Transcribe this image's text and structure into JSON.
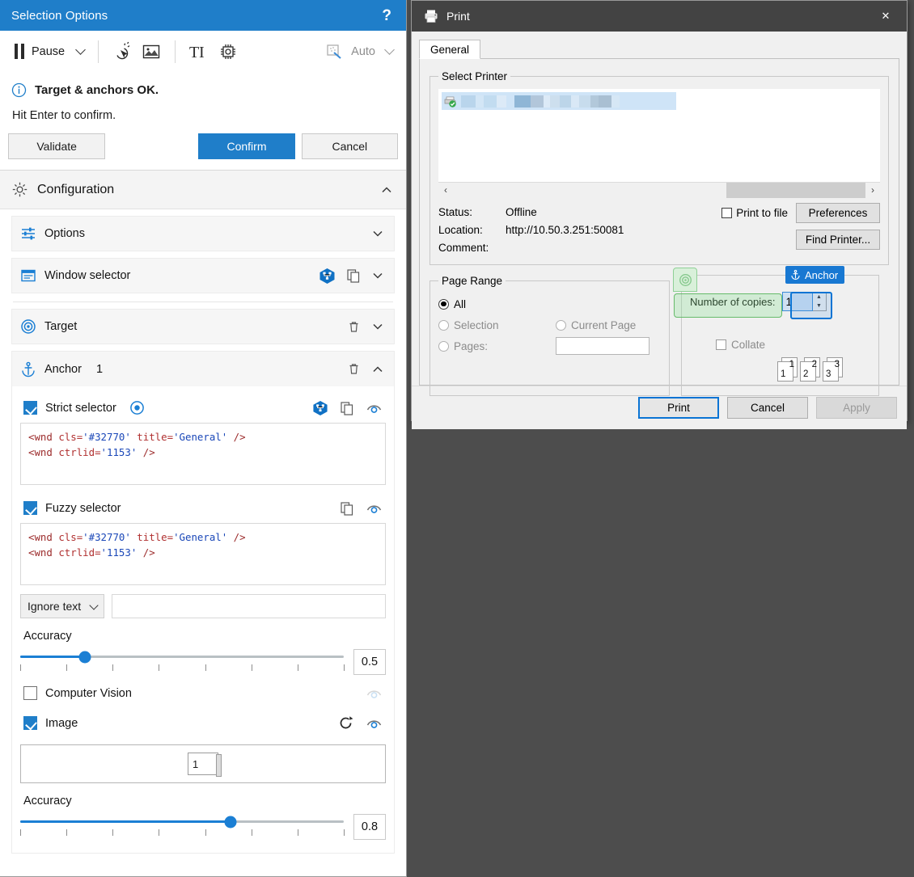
{
  "selection_panel": {
    "title": "Selection Options",
    "help_label": "?",
    "toolbar": {
      "pause_label": "Pause",
      "icons": [
        "click-action-icon",
        "image-capture-icon",
        "text-capture-icon",
        "cpu-automation-icon"
      ],
      "auto_label": "Auto"
    },
    "status": {
      "headline": "Target & anchors OK.",
      "subtext": "Hit Enter to confirm."
    },
    "buttons": {
      "validate": "Validate",
      "confirm": "Confirm",
      "cancel": "Cancel"
    },
    "configuration": {
      "title": "Configuration",
      "cards": [
        {
          "label": "Options",
          "icon": "sliders-icon"
        },
        {
          "label": "Window selector",
          "icon": "window-icon"
        }
      ],
      "target": {
        "label": "Target",
        "icon": "target-icon"
      },
      "anchor": {
        "label": "Anchor",
        "index": "1",
        "icon": "anchor-icon"
      }
    },
    "anchor_body": {
      "strict_selector": {
        "label": "Strict selector",
        "checked": true,
        "code_line1_parts": {
          "tag1": "<wnd ",
          "attr1": "cls=",
          "val1": "'#32770'",
          "attr2": " title=",
          "val2": "'General'",
          "close": " />"
        },
        "code_line2_parts": {
          "tag1": "<wnd ",
          "attr1": "ctrlid=",
          "val1": "'1153'",
          "close": " />"
        }
      },
      "fuzzy_selector": {
        "label": "Fuzzy selector",
        "checked": true,
        "code_line1_parts": {
          "tag1": "<wnd ",
          "attr1": "cls=",
          "val1": "'#32770'",
          "attr2": " title=",
          "val2": "'General'",
          "close": " />"
        },
        "code_line2_parts": {
          "tag1": "<wnd ",
          "attr1": "ctrlid=",
          "val1": "'1153'",
          "close": " />"
        }
      },
      "ignore_text": {
        "label": "Ignore text",
        "value": ""
      },
      "accuracy_selector": {
        "label": "Accuracy",
        "value": "0.5",
        "percent": 20
      },
      "computer_vision": {
        "label": "Computer Vision",
        "checked": false
      },
      "image": {
        "label": "Image",
        "checked": true,
        "thumb_value": "1"
      },
      "accuracy_image": {
        "label": "Accuracy",
        "value": "0.8",
        "percent": 65
      }
    }
  },
  "print_dialog": {
    "title": "Print",
    "close_label": "✕",
    "tabs": [
      {
        "label": "General",
        "active": true
      }
    ],
    "select_printer": {
      "legend": "Select Printer",
      "printer_name_redacted": true
    },
    "details": {
      "status_key": "Status:",
      "status_value": "Offline",
      "location_key": "Location:",
      "location_value": "http://10.50.3.251:50081",
      "comment_key": "Comment:",
      "comment_value": ""
    },
    "print_to_file": {
      "label": "Print to file",
      "checked": false
    },
    "preferences_label": "Preferences",
    "find_printer_label": "Find Printer...",
    "page_range": {
      "legend": "Page Range",
      "options": [
        {
          "label": "All",
          "selected": true,
          "enabled": true
        },
        {
          "label": "Selection",
          "selected": false,
          "enabled": false
        },
        {
          "label": "Current Page",
          "selected": false,
          "enabled": false
        },
        {
          "label": "Pages:",
          "selected": false,
          "enabled": false
        }
      ],
      "pages_value": ""
    },
    "copies": {
      "number_of_copies_label": "Number of copies:",
      "number_of_copies_value": "1",
      "collate_label": "Collate",
      "collate_checked": false,
      "collate_page_numbers": [
        "1",
        "2",
        "3"
      ]
    },
    "overlays": {
      "target_badge_icon": "target-icon",
      "anchor_badge_label": "Anchor",
      "anchor_badge_icon": "anchor-icon"
    },
    "footer": {
      "print": "Print",
      "cancel": "Cancel",
      "apply": "Apply"
    }
  },
  "colors": {
    "accent_blue": "#1f7ec9",
    "titlebar_dark": "#434343",
    "desktop_gray": "#4d4d4d",
    "highlight_green": "#66bb6a",
    "highlight_blue": "#0a74d4"
  }
}
